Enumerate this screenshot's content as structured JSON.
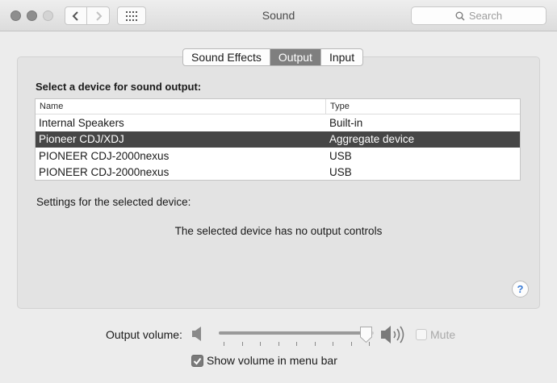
{
  "window": {
    "title": "Sound",
    "search_placeholder": "Search",
    "icons": {
      "close": "close-button",
      "minimize": "minimize-button",
      "zoom": "zoom-button",
      "back": "chevron-left-icon",
      "forward": "chevron-right-icon",
      "show_all": "grid-icon",
      "search": "search-icon"
    }
  },
  "tabs": [
    {
      "label": "Sound Effects",
      "active": false
    },
    {
      "label": "Output",
      "active": true
    },
    {
      "label": "Input",
      "active": false
    }
  ],
  "output": {
    "section_title": "Select a device for sound output:",
    "columns": {
      "name": "Name",
      "type": "Type"
    },
    "devices": [
      {
        "name": "Internal Speakers",
        "type": "Built-in",
        "selected": false
      },
      {
        "name": "Pioneer CDJ/XDJ",
        "type": "Aggregate device",
        "selected": true
      },
      {
        "name": "PIONEER CDJ-2000nexus",
        "type": "USB",
        "selected": false
      },
      {
        "name": "PIONEER CDJ-2000nexus",
        "type": "USB",
        "selected": false
      }
    ],
    "settings_label": "Settings for the selected device:",
    "no_controls_message": "The selected device has no output controls",
    "help_label": "?"
  },
  "volume": {
    "label": "Output volume:",
    "level": 0.95,
    "mute_label": "Mute",
    "mute_checked": false,
    "mute_enabled": false,
    "show_in_menu_bar_label": "Show volume in menu bar",
    "show_in_menu_bar_checked": true
  },
  "colors": {
    "selected_row": "#464646",
    "active_tab": "#7f7f7f",
    "window_bg": "#ececec"
  }
}
